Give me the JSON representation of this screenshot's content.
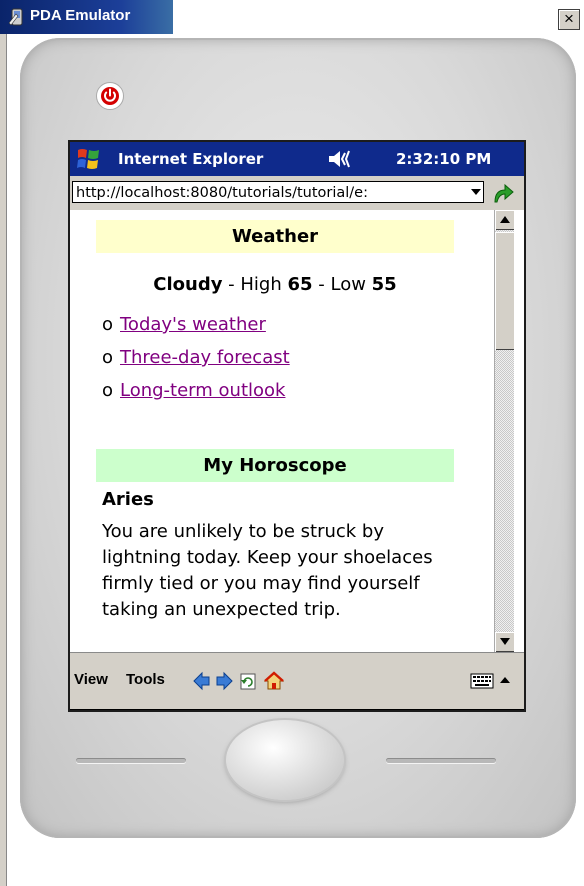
{
  "window": {
    "title": "PDA Emulator",
    "close_label": "×"
  },
  "pda": {
    "app_title": "Internet Explorer",
    "clock": "2:32:10 PM",
    "address": "http://localhost:8080/tutorials/tutorial/e:",
    "icons": {
      "power": "power-icon",
      "start": "windows-flag-icon",
      "volume": "speaker-icon",
      "go": "go-arrow-icon"
    }
  },
  "content": {
    "weather_header": "Weather",
    "condition": "Cloudy",
    "high_label": " - High ",
    "high_value": "65",
    "low_label": " - Low ",
    "low_value": "55",
    "bullet": "o",
    "links": [
      {
        "label": "Today's weather"
      },
      {
        "label": "Three-day forecast"
      },
      {
        "label": "Long-term outlook"
      }
    ],
    "horoscope_header": "My Horoscope",
    "sign": "Aries",
    "horoscope_text": "You are unlikely to be struck by lightning today. Keep your shoelaces firmly tied or you may find yourself taking an unexpected trip."
  },
  "toolbar": {
    "view_label": "View",
    "tools_label": "Tools"
  },
  "colors": {
    "weather_bg": "#ffffcc",
    "horoscope_bg": "#ccffcc",
    "link": "#800080",
    "titlebar": "#0f2a8c"
  }
}
